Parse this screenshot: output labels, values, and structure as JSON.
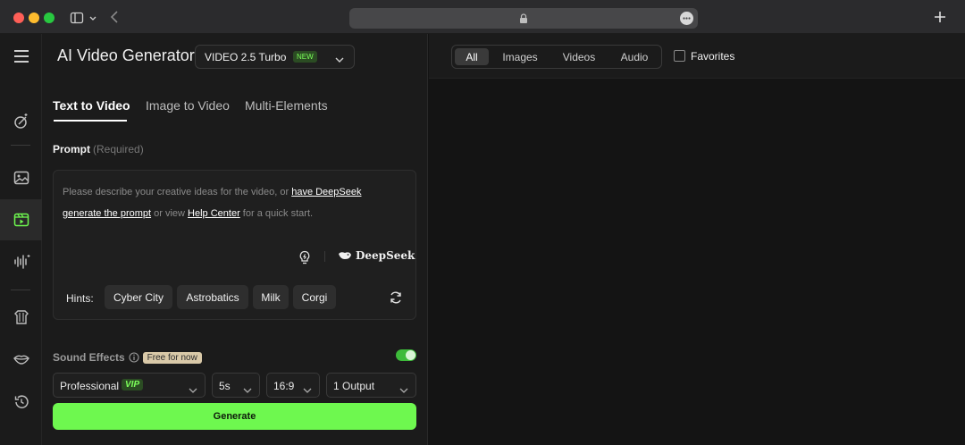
{
  "app": {
    "title": "AI Video Generator",
    "model": "VIDEO 2.5 Turbo",
    "model_badge": "NEW"
  },
  "tabs": [
    "Text to Video",
    "Image to Video",
    "Multi-Elements"
  ],
  "prompt": {
    "label": "Prompt",
    "required": "(Required)",
    "text_1": "Please describe your creative ideas for the video, or ",
    "link_1": "have DeepSeek",
    "link_1b": "generate the prompt",
    "text_2": " or view ",
    "link_2": "Help Center",
    "text_3": " for a quick start.",
    "deepseek": "DeepSeek"
  },
  "hints": {
    "label": "Hints:",
    "items": [
      "Cyber City",
      "Astrobatics",
      "Milk",
      "Corgi"
    ]
  },
  "sound_effects": {
    "label": "Sound Effects",
    "badge": "Free for now",
    "enabled": true
  },
  "options": {
    "mode": "Professional",
    "mode_badge": "VIP",
    "duration": "5s",
    "aspect": "16:9",
    "outputs": "1 Output"
  },
  "generate_label": "Generate",
  "filters": {
    "items": [
      "All",
      "Images",
      "Videos",
      "Audio"
    ],
    "active": "All",
    "favorites_label": "Favorites"
  },
  "colors": {
    "accent": "#6ef84f",
    "background": "#141414",
    "panel": "#1b1b1b"
  }
}
